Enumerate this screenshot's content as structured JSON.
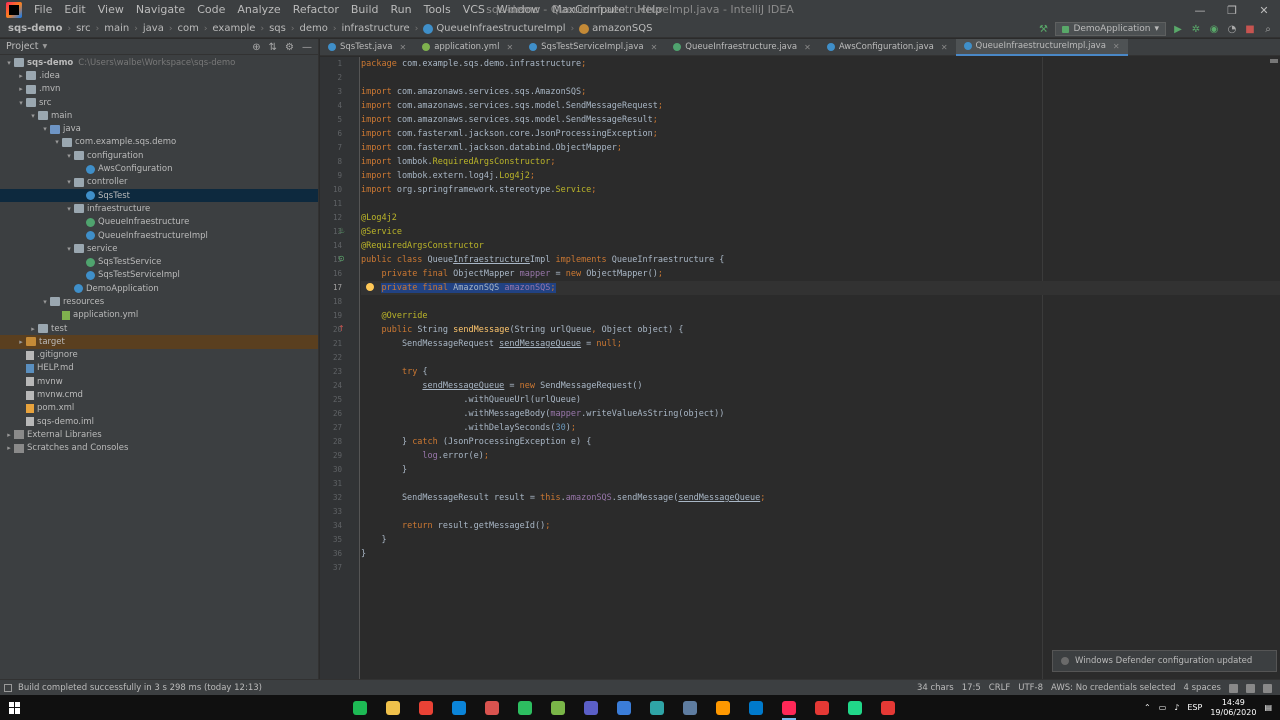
{
  "window": {
    "title": "sqs-demo - QueueInfraestructureImpl.java - IntelliJ IDEA",
    "menu": [
      "File",
      "Edit",
      "View",
      "Navigate",
      "Code",
      "Analyze",
      "Refactor",
      "Build",
      "Run",
      "Tools",
      "VCS",
      "Window",
      "MaxCompute",
      "Help"
    ],
    "controls": [
      "—",
      "❐",
      "✕"
    ]
  },
  "breadcrumbs": [
    "sqs-demo",
    "src",
    "main",
    "java",
    "com",
    "example",
    "sqs",
    "demo",
    "infrastructure",
    "QueueInfraestructureImpl",
    "amazonSQS"
  ],
  "run_config": "DemoApplication",
  "project_panel": {
    "title": "Project",
    "tree": [
      {
        "label": "sqs-demo",
        "extra": "C:\\Users\\walbe\\Workspace\\sqs-demo",
        "depth": 0,
        "arrow": "▾",
        "icon": "folder",
        "bold": true
      },
      {
        "label": ".idea",
        "depth": 1,
        "arrow": "▸",
        "icon": "folder"
      },
      {
        "label": ".mvn",
        "depth": 1,
        "arrow": "▸",
        "icon": "folder"
      },
      {
        "label": "src",
        "depth": 1,
        "arrow": "▾",
        "icon": "folder"
      },
      {
        "label": "main",
        "depth": 2,
        "arrow": "▾",
        "icon": "folder"
      },
      {
        "label": "java",
        "depth": 3,
        "arrow": "▾",
        "icon": "folder-blue"
      },
      {
        "label": "com.example.sqs.demo",
        "depth": 4,
        "arrow": "▾",
        "icon": "folder"
      },
      {
        "label": "configuration",
        "depth": 5,
        "arrow": "▾",
        "icon": "folder"
      },
      {
        "label": "AwsConfiguration",
        "depth": 6,
        "arrow": "",
        "icon": "class"
      },
      {
        "label": "controller",
        "depth": 5,
        "arrow": "▾",
        "icon": "folder"
      },
      {
        "label": "SqsTest",
        "depth": 6,
        "arrow": "",
        "icon": "class",
        "selected": true
      },
      {
        "label": "infraestructure",
        "depth": 5,
        "arrow": "▾",
        "icon": "folder"
      },
      {
        "label": "QueueInfraestructure",
        "depth": 6,
        "arrow": "",
        "icon": "iface"
      },
      {
        "label": "QueueInfraestructureImpl",
        "depth": 6,
        "arrow": "",
        "icon": "class"
      },
      {
        "label": "service",
        "depth": 5,
        "arrow": "▾",
        "icon": "folder"
      },
      {
        "label": "SqsTestService",
        "depth": 6,
        "arrow": "",
        "icon": "iface"
      },
      {
        "label": "SqsTestServiceImpl",
        "depth": 6,
        "arrow": "",
        "icon": "class"
      },
      {
        "label": "DemoApplication",
        "depth": 5,
        "arrow": "",
        "icon": "class"
      },
      {
        "label": "resources",
        "depth": 3,
        "arrow": "▾",
        "icon": "folder"
      },
      {
        "label": "application.yml",
        "depth": 4,
        "arrow": "",
        "icon": "yml"
      },
      {
        "label": "test",
        "depth": 2,
        "arrow": "▸",
        "icon": "folder"
      },
      {
        "label": "target",
        "depth": 1,
        "arrow": "▸",
        "icon": "folder-orange",
        "excluded": true
      },
      {
        "label": ".gitignore",
        "depth": 1,
        "arrow": "",
        "icon": "file"
      },
      {
        "label": "HELP.md",
        "depth": 1,
        "arrow": "",
        "icon": "md"
      },
      {
        "label": "mvnw",
        "depth": 1,
        "arrow": "",
        "icon": "file"
      },
      {
        "label": "mvnw.cmd",
        "depth": 1,
        "arrow": "",
        "icon": "file"
      },
      {
        "label": "pom.xml",
        "depth": 1,
        "arrow": "",
        "icon": "xml"
      },
      {
        "label": "sqs-demo.iml",
        "depth": 1,
        "arrow": "",
        "icon": "file"
      },
      {
        "label": "External Libraries",
        "depth": 0,
        "arrow": "▸",
        "icon": "lib"
      },
      {
        "label": "Scratches and Consoles",
        "depth": 0,
        "arrow": "▸",
        "icon": "lib"
      }
    ]
  },
  "tabs": [
    {
      "label": "SqsTest.java",
      "color": "#3f8fc9",
      "active": false
    },
    {
      "label": "application.yml",
      "color": "#7fb14e",
      "active": false
    },
    {
      "label": "SqsTestServiceImpl.java",
      "color": "#3f8fc9",
      "active": false
    },
    {
      "label": "QueueInfraestructure.java",
      "color": "#4fa36e",
      "active": false
    },
    {
      "label": "AwsConfiguration.java",
      "color": "#3f8fc9",
      "active": false
    },
    {
      "label": "QueueInfraestructureImpl.java",
      "color": "#3f8fc9",
      "active": true
    }
  ],
  "editor": {
    "line_count": 37,
    "current_line": 17,
    "lines": [
      [
        [
          "kw",
          "package "
        ],
        [
          "",
          "com.example.sqs.demo.infrastructure"
        ],
        [
          "kw",
          ";"
        ]
      ],
      [],
      [
        [
          "kw",
          "import "
        ],
        [
          "",
          "com.amazonaws.services.sqs.AmazonSQS"
        ],
        [
          "kw",
          ";"
        ]
      ],
      [
        [
          "kw",
          "import "
        ],
        [
          "",
          "com.amazonaws.services.sqs.model.SendMessageRequest"
        ],
        [
          "kw",
          ";"
        ]
      ],
      [
        [
          "kw",
          "import "
        ],
        [
          "",
          "com.amazonaws.services.sqs.model.SendMessageResult"
        ],
        [
          "kw",
          ";"
        ]
      ],
      [
        [
          "kw",
          "import "
        ],
        [
          "",
          "com.fasterxml.jackson.core.JsonProcessingException"
        ],
        [
          "kw",
          ";"
        ]
      ],
      [
        [
          "kw",
          "import "
        ],
        [
          "",
          "com.fasterxml.jackson.databind.ObjectMapper"
        ],
        [
          "kw",
          ";"
        ]
      ],
      [
        [
          "kw",
          "import "
        ],
        [
          "",
          "lombok."
        ],
        [
          "ann",
          "RequiredArgsConstructor"
        ],
        [
          "kw",
          ";"
        ]
      ],
      [
        [
          "kw",
          "import "
        ],
        [
          "",
          "lombok.extern.log4j."
        ],
        [
          "ann",
          "Log4j2"
        ],
        [
          "kw",
          ";"
        ]
      ],
      [
        [
          "kw",
          "import "
        ],
        [
          "",
          "org.springframework.stereotype."
        ],
        [
          "ann",
          "Service"
        ],
        [
          "kw",
          ";"
        ]
      ],
      [],
      [
        [
          "ann",
          "@Log4j2"
        ]
      ],
      [
        [
          "ann",
          "@Service"
        ]
      ],
      [
        [
          "ann",
          "@RequiredArgsConstructor"
        ]
      ],
      [
        [
          "kw",
          "public class "
        ],
        [
          "",
          "Queue"
        ],
        [
          "ul",
          "Infraestructure"
        ],
        [
          "",
          "Impl "
        ],
        [
          "kw",
          "implements "
        ],
        [
          "",
          "QueueInfraestructure {"
        ]
      ],
      [
        [
          "",
          "    "
        ],
        [
          "kw",
          "private final "
        ],
        [
          "",
          "ObjectMapper "
        ],
        [
          "fld",
          "mapper"
        ],
        [
          "",
          " = "
        ],
        [
          "kw",
          "new "
        ],
        [
          "",
          "ObjectMapper()"
        ],
        [
          "kw",
          ";"
        ]
      ],
      [
        [
          "",
          "    "
        ],
        [
          "sel-kw",
          "private final "
        ],
        [
          "sel",
          "AmazonSQS "
        ],
        [
          "sel-fld",
          "amazonSQS"
        ],
        [
          "sel-kw",
          ";"
        ]
      ],
      [],
      [
        [
          "",
          "    "
        ],
        [
          "ann",
          "@Override"
        ]
      ],
      [
        [
          "",
          "    "
        ],
        [
          "kw",
          "public "
        ],
        [
          "",
          "String "
        ],
        [
          "mth",
          "sendMessage"
        ],
        [
          "",
          "(String urlQueue"
        ],
        [
          "kw",
          ", "
        ],
        [
          "",
          "Object object) {"
        ]
      ],
      [
        [
          "",
          "        SendMessageRequest "
        ],
        [
          "ul",
          "sendMessageQueue"
        ],
        [
          "",
          " = "
        ],
        [
          "kw",
          "null;"
        ]
      ],
      [],
      [
        [
          "",
          "        "
        ],
        [
          "kw",
          "try "
        ],
        [
          "",
          "{"
        ]
      ],
      [
        [
          "",
          "            "
        ],
        [
          "ul",
          "sendMessageQueue"
        ],
        [
          "",
          " = "
        ],
        [
          "kw",
          "new "
        ],
        [
          "",
          "SendMessageRequest()"
        ]
      ],
      [
        [
          "",
          "                    .withQueueUrl(urlQueue)"
        ]
      ],
      [
        [
          "",
          "                    .withMessageBody("
        ],
        [
          "fld",
          "mapper"
        ],
        [
          "",
          ".writeValueAsString(object))"
        ]
      ],
      [
        [
          "",
          "                    .withDelaySeconds("
        ],
        [
          "num",
          "30"
        ],
        [
          "",
          ")"
        ],
        [
          "kw",
          ";"
        ]
      ],
      [
        [
          "",
          "        } "
        ],
        [
          "kw",
          "catch "
        ],
        [
          "",
          "(JsonProcessingException e) {"
        ]
      ],
      [
        [
          "",
          "            "
        ],
        [
          "fld",
          "log"
        ],
        [
          "",
          ".error(e)"
        ],
        [
          "kw",
          ";"
        ]
      ],
      [
        [
          "",
          "        }"
        ]
      ],
      [],
      [
        [
          "",
          "        SendMessageResult result = "
        ],
        [
          "kw",
          "this"
        ],
        [
          "",
          "."
        ],
        [
          "fld",
          "amazonSQS"
        ],
        [
          "",
          ".sendMessage("
        ],
        [
          "ul",
          "sendMessageQueue"
        ],
        [
          ")"
        ],
        [
          "kw",
          ";"
        ]
      ],
      [],
      [
        [
          "",
          "        "
        ],
        [
          "kw",
          "return "
        ],
        [
          "",
          "result.getMessageId()"
        ],
        [
          "kw",
          ";"
        ]
      ],
      [
        [
          "",
          "    }"
        ]
      ],
      [
        [
          "",
          "}"
        ]
      ],
      []
    ]
  },
  "notification": "Windows Defender configuration updated",
  "status": {
    "message": "Build completed successfully in 3 s 298 ms (today 12:13)",
    "right": [
      "34 chars",
      "17:5",
      "CRLF",
      "UTF-8",
      "AWS: No credentials selected",
      "4 spaces"
    ]
  },
  "taskbar": {
    "apps": [
      {
        "name": "spotify",
        "color": "#1db954"
      },
      {
        "name": "file-explorer",
        "color": "#f0c14b"
      },
      {
        "name": "chrome",
        "color": "#e94235"
      },
      {
        "name": "edge",
        "color": "#0b84d8"
      },
      {
        "name": "git-kraken",
        "color": "#d9534f"
      },
      {
        "name": "evernote",
        "color": "#2dbe60"
      },
      {
        "name": "aws-toolkit",
        "color": "#7ab648"
      },
      {
        "name": "teams",
        "color": "#5b5fc7"
      },
      {
        "name": "network-tool",
        "color": "#3b7dd8"
      },
      {
        "name": "app-green",
        "color": "#2fa4a6"
      },
      {
        "name": "app-db",
        "color": "#5e7ca0"
      },
      {
        "name": "sublime",
        "color": "#ff9800"
      },
      {
        "name": "vscode",
        "color": "#007acc"
      },
      {
        "name": "intellij",
        "color": "#fe2857",
        "active": true
      },
      {
        "name": "app-red",
        "color": "#e53935"
      },
      {
        "name": "clion",
        "color": "#21d789"
      },
      {
        "name": "app-red2",
        "color": "#e53935"
      }
    ],
    "lang": "ESP",
    "time": "14:49",
    "date": "19/06/2020"
  }
}
